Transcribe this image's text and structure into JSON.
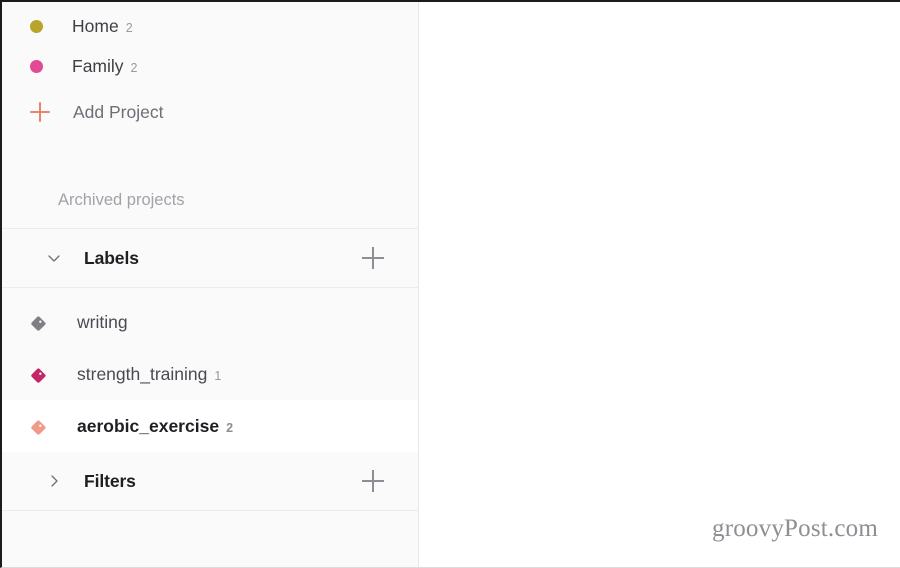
{
  "sidebar": {
    "projects": [
      {
        "label": "Home",
        "count": "2",
        "dot_color": "#b9a42b",
        "icon": "circle-dot-icon"
      },
      {
        "label": "Family",
        "count": "2",
        "dot_color": "#e24a93",
        "icon": "circle-dot-icon"
      }
    ],
    "add_project": {
      "label": "Add Project",
      "icon": "plus-icon",
      "color": "#e8846c"
    },
    "archived": {
      "label": "Archived projects"
    },
    "labels_section": {
      "title": "Labels",
      "chevron": "chevron-down-icon",
      "add_icon": "plus-icon",
      "expanded": true
    },
    "labels": [
      {
        "label": "writing",
        "count": "",
        "tag_color": "#7f7f86",
        "icon": "tag-icon",
        "selected": false
      },
      {
        "label": "strength_training",
        "count": "1",
        "tag_color": "#c42766",
        "icon": "tag-icon",
        "selected": false
      },
      {
        "label": "aerobic_exercise",
        "count": "2",
        "tag_color": "#f09a8a",
        "icon": "tag-icon",
        "selected": true
      }
    ],
    "filters_section": {
      "title": "Filters",
      "chevron": "chevron-right-icon",
      "add_icon": "plus-icon",
      "expanded": false
    }
  },
  "main": {
    "watermark": "groovyPost.com"
  },
  "colors": {
    "sidebar_bg": "#fafafa",
    "main_bg": "#ffffff",
    "divider": "#ececec",
    "accent_coral": "#e8846c"
  }
}
